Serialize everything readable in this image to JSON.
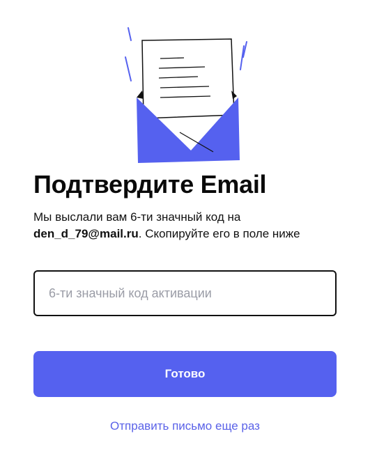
{
  "colors": {
    "accent": "#5561ef",
    "link": "#5a62e8",
    "text": "#111111",
    "placeholder": "#9a9ca6",
    "field_border": "#111111"
  },
  "illustration": {
    "icon": "envelope-with-letter-icon"
  },
  "page": {
    "title": "Подтвердите Email",
    "description_prefix": "Мы выслали вам 6-ти значный код на ",
    "email": "den_d_79@mail.ru",
    "description_suffix": ". Скопируйте его в поле ниже"
  },
  "form": {
    "code_value": "",
    "code_placeholder": "6-ти значный код активации",
    "submit_label": "Готово",
    "resend_label": "Отправить письмо еще раз"
  }
}
